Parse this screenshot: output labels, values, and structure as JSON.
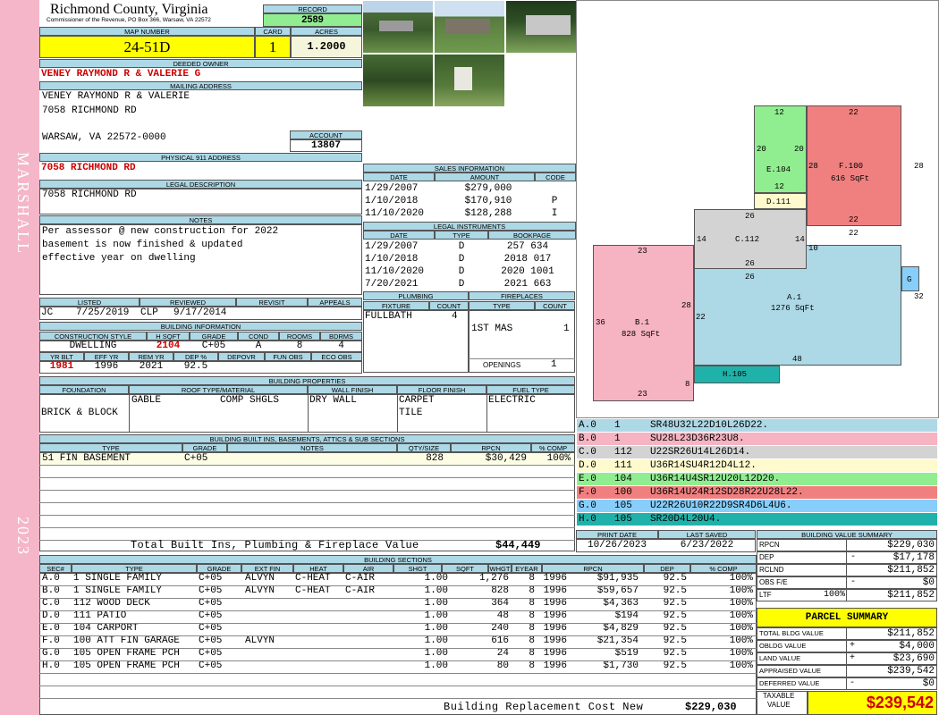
{
  "side": {
    "top_text": "MARSHALL",
    "bottom_text": "2023"
  },
  "header": {
    "county": "Richmond County, Virginia",
    "commissioner": "Commissioner of the Revenue, PO Box 366, Warsaw, VA 22572",
    "record_label": "RECORD",
    "record": "2589",
    "map_label": "MAP NUMBER",
    "map": "24-51D",
    "card_label": "CARD",
    "card": "1",
    "acres_label": "ACRES",
    "acres": "1.2000"
  },
  "owner": {
    "deeded_label": "DEEDED OWNER",
    "deeded": "VENEY RAYMOND R & VALERIE G",
    "mailing_label": "MAILING ADDRESS",
    "mail1": "VENEY RAYMOND R & VALERIE",
    "mail2": "7058 RICHMOND RD",
    "mail3": "WARSAW, VA 22572-0000",
    "account_label": "ACCOUNT",
    "account": "13807",
    "physical_label": "PHYSICAL 911 ADDRESS",
    "physical": "7058 RICHMOND RD",
    "legal_label": "LEGAL DESCRIPTION",
    "legal": "7058 RICHMOND RD",
    "notes_label": "NOTES",
    "notes1": "Per assessor @ new construction for 2022",
    "notes2": "basement is now finished & updated",
    "notes3": "effective year on dwelling"
  },
  "sales": {
    "title": "SALES INFORMATION",
    "headers": [
      "DATE",
      "AMOUNT",
      "CODE"
    ],
    "rows": [
      [
        "1/29/2007",
        "$279,000",
        ""
      ],
      [
        "1/10/2018",
        "$170,910",
        "P"
      ],
      [
        "11/10/2020",
        "$128,288",
        "I"
      ]
    ]
  },
  "legal_inst": {
    "title": "LEGAL INSTRUMENTS",
    "headers": [
      "DATE",
      "TYPE",
      "BOOKPAGE"
    ],
    "rows": [
      [
        "1/29/2007",
        "D",
        "257 634"
      ],
      [
        "1/10/2018",
        "D",
        "2018 017"
      ],
      [
        "11/10/2020",
        "D",
        "2020 1001"
      ],
      [
        "7/20/2021",
        "D",
        "2021 663"
      ]
    ]
  },
  "listed": {
    "labels": [
      "LISTED",
      "REVIEWED",
      "REVISIT",
      "APPEALS"
    ],
    "listed_by": "JC",
    "listed_date": "7/25/2019",
    "reviewed_by": "CLP",
    "reviewed_date": "9/17/2014"
  },
  "plumbing": {
    "title": "PLUMBING",
    "h1": "FIXTURE",
    "h2": "COUNT",
    "fixture": "FULLBATH",
    "count": "4"
  },
  "fireplaces": {
    "title": "FIREPLACES",
    "h1": "TYPE",
    "h2": "COUNT",
    "type": "1ST MAS",
    "count": "1",
    "openings_label": "OPENINGS",
    "openings": "1"
  },
  "building_info": {
    "title": "BUILDING INFORMATION",
    "h": [
      "CONSTRUCTION STYLE",
      "H SQFT",
      "GRADE",
      "COND",
      "ROOMS",
      "BDRMS"
    ],
    "v": [
      "DWELLING",
      "2104",
      "C+05",
      "A",
      "8",
      "4"
    ],
    "h2": [
      "YR BLT",
      "EFF YR",
      "REM YR",
      "DEP %",
      "DEPOVR",
      "FUN OBS",
      "ECO OBS"
    ],
    "v2": [
      "1981",
      "1996",
      "2021",
      "92.5",
      "",
      "",
      ""
    ]
  },
  "properties": {
    "title": "BUILDING PROPERTIES",
    "h": [
      "FOUNDATION",
      "ROOF TYPE/MATERIAL",
      "WALL FINISH",
      "FLOOR FINISH",
      "FUEL TYPE"
    ],
    "foundation": "BRICK & BLOCK",
    "roof_type": "GABLE",
    "roof_mat": "COMP SHGLS",
    "wall": "DRY WALL",
    "floor1": "CARPET",
    "floor2": "TILE",
    "fuel": "ELECTRIC"
  },
  "builtins": {
    "title": "BUILDING BUILT INS, BASEMENTS, ATTICS & SUB SECTIONS",
    "h": [
      "TYPE",
      "GRADE",
      "NOTES",
      "QTY/SIZE",
      "RPCN",
      "% COMP"
    ],
    "row": [
      "51 FIN BASEMENT",
      "C+05",
      "",
      "828",
      "$30,429",
      "100%"
    ],
    "total_label": "Total Built Ins, Plumbing & Fireplace Value",
    "total": "$44,449"
  },
  "sections": {
    "title": "BUILDING SECTIONS",
    "h": [
      "SEC#",
      "TYPE",
      "GRADE",
      "EXT FIN",
      "HEAT",
      "AIR",
      "SHGT",
      "SQFT",
      "WHGT",
      "EYEAR",
      "RPCN",
      "DEP",
      "% COMP"
    ],
    "rows": [
      [
        "A.0",
        "1 SINGLE FAMILY",
        "C+05",
        "ALVYN",
        "C-HEAT",
        "C-AIR",
        "1.00",
        "1,276",
        "8",
        "1996",
        "$91,935",
        "92.5",
        "100%"
      ],
      [
        "B.0",
        "1 SINGLE FAMILY",
        "C+05",
        "ALVYN",
        "C-HEAT",
        "C-AIR",
        "1.00",
        "828",
        "8",
        "1996",
        "$59,657",
        "92.5",
        "100%"
      ],
      [
        "C.0",
        "112 WOOD DECK",
        "C+05",
        "",
        "",
        "",
        "1.00",
        "364",
        "8",
        "1996",
        "$4,363",
        "92.5",
        "100%"
      ],
      [
        "D.0",
        "111 PATIO",
        "C+05",
        "",
        "",
        "",
        "1.00",
        "48",
        "8",
        "1996",
        "$194",
        "92.5",
        "100%"
      ],
      [
        "E.0",
        "104 CARPORT",
        "C+05",
        "",
        "",
        "",
        "1.00",
        "240",
        "8",
        "1996",
        "$4,829",
        "92.5",
        "100%"
      ],
      [
        "F.0",
        "100 ATT FIN GARAGE",
        "C+05",
        "ALVYN",
        "",
        "",
        "1.00",
        "616",
        "8",
        "1996",
        "$21,354",
        "92.5",
        "100%"
      ],
      [
        "G.0",
        "105 OPEN FRAME PCH",
        "C+05",
        "",
        "",
        "",
        "1.00",
        "24",
        "8",
        "1996",
        "$519",
        "92.5",
        "100%"
      ],
      [
        "H.0",
        "105 OPEN FRAME PCH",
        "C+05",
        "",
        "",
        "",
        "1.00",
        "80",
        "8",
        "1996",
        "$1,730",
        "92.5",
        "100%"
      ]
    ],
    "total_label": "Building Replacement Cost New",
    "total": "$229,030"
  },
  "sketch": {
    "areas": [
      {
        "id": "a",
        "name": "A.1",
        "area": "1276 SqFt",
        "color": "#add8e6"
      },
      {
        "id": "b",
        "name": "B.1",
        "area": "828 SqFt",
        "color": "#f6b3c2"
      },
      {
        "id": "c",
        "name": "C.112",
        "area": "",
        "color": "#d3d3d3"
      },
      {
        "id": "d",
        "name": "D.111",
        "area": "",
        "color": "#fffacd"
      },
      {
        "id": "e",
        "name": "E.104",
        "area": "",
        "color": "#90ee90"
      },
      {
        "id": "f",
        "name": "F.100",
        "area": "616 SqFt",
        "color": "#f08080"
      },
      {
        "id": "g",
        "name": "G",
        "area": "",
        "color": "#87cefa"
      },
      {
        "id": "h",
        "name": "H.105",
        "area": "",
        "color": "#20b2aa"
      }
    ],
    "dims": [
      "12",
      "22",
      "20",
      "20",
      "28",
      "28",
      "12",
      "22",
      "22",
      "26",
      "14",
      "14",
      "10",
      "26",
      "26",
      "23",
      "28",
      "22",
      "32",
      "36",
      "48",
      "8",
      "23"
    ]
  },
  "vectors": [
    {
      "code": "A.0",
      "n": "1",
      "v": "SR48U32L22D10L26D22.",
      "color": "#add8e6"
    },
    {
      "code": "B.0",
      "n": "1",
      "v": "SU28L23D36R23U8.",
      "color": "#f6b3c2"
    },
    {
      "code": "C.0",
      "n": "112",
      "v": "U22SR26U14L26D14.",
      "color": "#d3d3d3"
    },
    {
      "code": "D.0",
      "n": "111",
      "v": "U36R14SU4R12D4L12.",
      "color": "#fffacd"
    },
    {
      "code": "E.0",
      "n": "104",
      "v": "U36R14U4SR12U20L12D20.",
      "color": "#90ee90"
    },
    {
      "code": "F.0",
      "n": "100",
      "v": "U36R14U24R12SD28R22U28L22.",
      "color": "#f08080"
    },
    {
      "code": "G.0",
      "n": "105",
      "v": "U22R26U10R22D9SR4D6L4U6.",
      "color": "#87cefa"
    },
    {
      "code": "H.0",
      "n": "105",
      "v": "SR20D4L20U4.",
      "color": "#20b2aa"
    }
  ],
  "dates": {
    "print_label": "PRINT DATE",
    "print": "10/26/2023",
    "saved_label": "LAST SAVED",
    "saved": "6/23/2022"
  },
  "bvs": {
    "title": "BUILDING VALUE SUMMARY",
    "rows": [
      {
        "l": "RPCN",
        "m": "",
        "s": "",
        "v": "$229,030"
      },
      {
        "l": "DEP",
        "m": "",
        "s": "-",
        "v": "$17,178"
      },
      {
        "l": "RCLND",
        "m": "",
        "s": "",
        "v": "$211,852"
      },
      {
        "l": "OBS F/E",
        "m": "",
        "s": "-",
        "v": "$0"
      },
      {
        "l": "LTF",
        "m": "100%",
        "s": "",
        "v": "$211,852"
      }
    ]
  },
  "parcel": {
    "title": "PARCEL SUMMARY",
    "rows": [
      {
        "l": "TOTAL BLDG VALUE",
        "s": "",
        "v": "$211,852"
      },
      {
        "l": "OBLDG VALUE",
        "s": "+",
        "v": "$4,000"
      },
      {
        "l": "LAND VALUE",
        "s": "+",
        "v": "$23,690"
      },
      {
        "l": "APPRAISED VALUE",
        "s": "",
        "v": "$239,542"
      },
      {
        "l": "DEFERRED VALUE",
        "s": "-",
        "v": "$0"
      }
    ],
    "taxable_l1": "TAXABLE",
    "taxable_l2": "VALUE",
    "taxable": "$239,542"
  }
}
